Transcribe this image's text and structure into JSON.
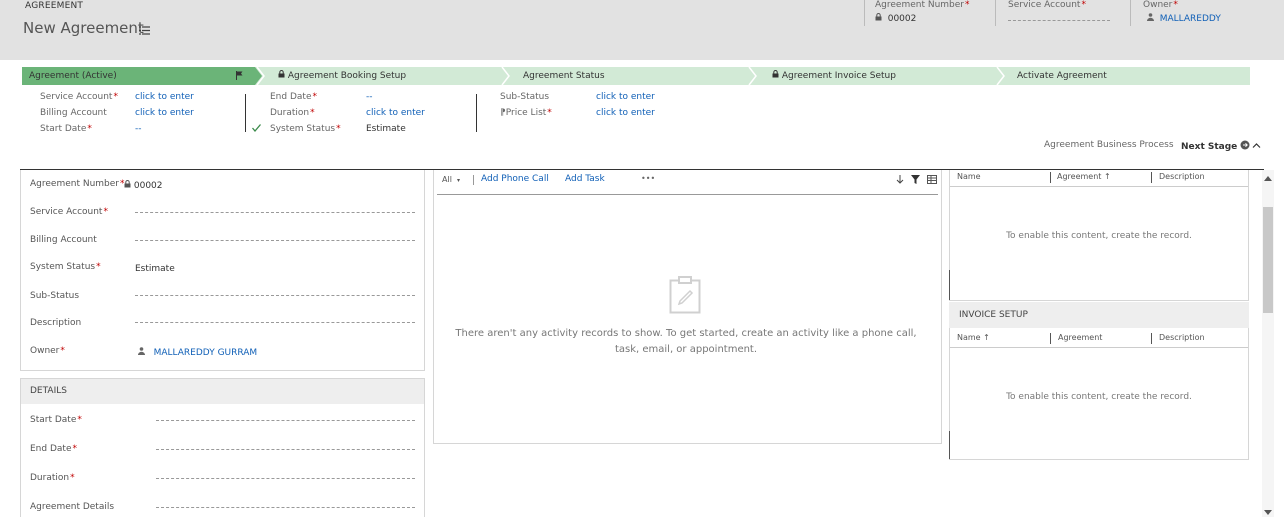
{
  "header": {
    "entity": "AGREEMENT",
    "title": "New Agreement",
    "fields": [
      {
        "label": "Agreement Number",
        "required": true,
        "value": "00002",
        "locked": true
      },
      {
        "label": "Service Account",
        "required": true,
        "value": ""
      },
      {
        "label": "Owner",
        "required": true,
        "value": "MALLAREDDY",
        "isUser": true
      }
    ]
  },
  "process": {
    "stages": [
      {
        "label": "Agreement (Active)",
        "active": true
      },
      {
        "label": "Agreement Booking Setup",
        "locked": true
      },
      {
        "label": "Agreement Status"
      },
      {
        "label": "Agreement Invoice Setup",
        "locked": true
      },
      {
        "label": "Activate Agreement"
      }
    ],
    "col1": [
      {
        "label": "Service Account",
        "required": true,
        "value": "click to enter"
      },
      {
        "label": "Billing Account",
        "required": false,
        "value": "click to enter"
      },
      {
        "label": "Start Date",
        "required": true,
        "value": "--"
      }
    ],
    "col2": [
      {
        "label": "End Date",
        "required": true,
        "value": "--"
      },
      {
        "label": "Duration",
        "required": true,
        "value": "click to enter"
      },
      {
        "label": "System Status",
        "required": true,
        "value": "Estimate"
      }
    ],
    "col3": [
      {
        "label": "Sub-Status",
        "required": false,
        "value": "click to enter"
      },
      {
        "label": "Price List",
        "required": true,
        "value": "click to enter"
      }
    ],
    "business_process_label": "Agreement Business Process",
    "next_stage_label": "Next Stage"
  },
  "general": {
    "rows": [
      {
        "label": "Agreement Number",
        "required": true,
        "value": "00002"
      },
      {
        "label": "Service Account",
        "required": true,
        "value": ""
      },
      {
        "label": "Billing Account",
        "required": false,
        "value": ""
      },
      {
        "label": "System Status",
        "required": true,
        "value": "Estimate"
      },
      {
        "label": "Sub-Status",
        "required": false,
        "value": ""
      },
      {
        "label": "Description",
        "required": false,
        "value": ""
      },
      {
        "label": "Owner",
        "required": true,
        "value": "MALLAREDDY GURRAM"
      }
    ]
  },
  "details": {
    "title": "DETAILS",
    "rows": [
      {
        "label": "Start Date",
        "required": true
      },
      {
        "label": "End Date",
        "required": true
      },
      {
        "label": "Duration",
        "required": true
      },
      {
        "label": "Agreement Details",
        "required": false
      }
    ]
  },
  "activities": {
    "filter": "All",
    "add_phone_call": "Add Phone Call",
    "add_task": "Add Task",
    "more": "•••",
    "empty_message": "There aren't any activity records to show. To get started, create an activity like a phone call, task, email, or appointment."
  },
  "grid1": {
    "columns": [
      "Name",
      "Agreement ↑",
      "Description"
    ],
    "empty": "To enable this content, create the record."
  },
  "grid2": {
    "title": "INVOICE SETUP",
    "columns": [
      "Name ↑",
      "Agreement",
      "Description"
    ],
    "empty": "To enable this content, create the record."
  }
}
